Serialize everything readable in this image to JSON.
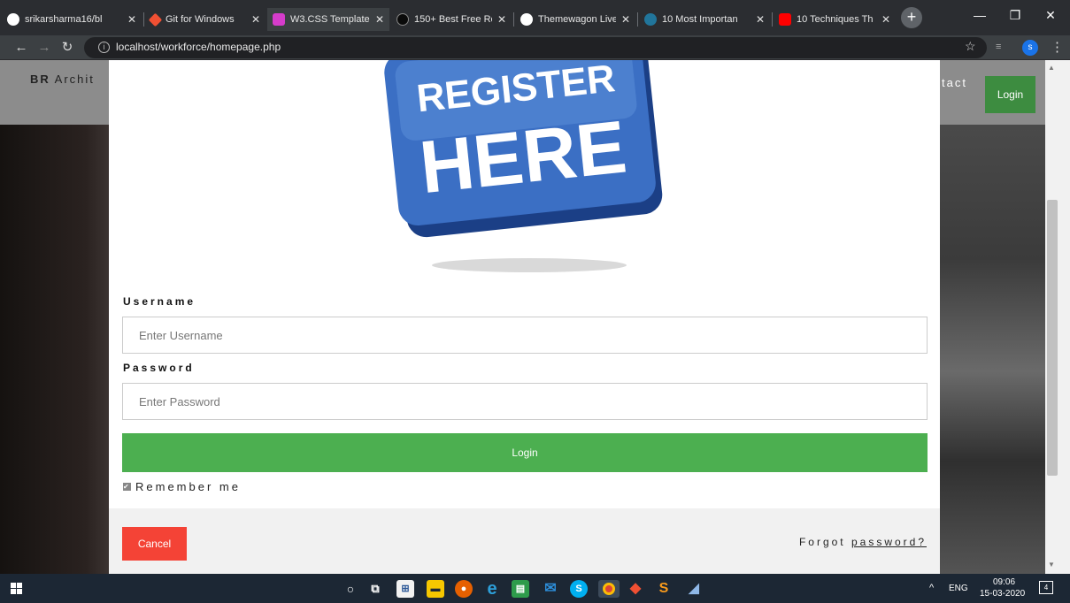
{
  "browser": {
    "tabs": [
      {
        "title": "srikarsharma16/bl",
        "icon": "github-icon",
        "color": "#ffffff"
      },
      {
        "title": "Git for Windows",
        "icon": "git-icon",
        "color": "#f05033"
      },
      {
        "title": "W3.CSS Template",
        "icon": "w3css-icon",
        "color": "#d63ccb"
      },
      {
        "title": "150+ Best Free Re",
        "icon": "themefisher-icon",
        "color": "#0a0a0a"
      },
      {
        "title": "Themewagon Live",
        "icon": "themewagon-icon",
        "color": "#ffffff"
      },
      {
        "title": "10 Most Importan",
        "icon": "wordpress-icon",
        "color": "#21759b"
      },
      {
        "title": "10 Techniques Th",
        "icon": "youtube-icon",
        "color": "#ff0000"
      }
    ],
    "close_glyph": "✕",
    "newtab_glyph": "+",
    "url": "localhost/workforce/homepage.php",
    "info_glyph": "i",
    "profile_initial": "s",
    "window": {
      "minimize": "—",
      "restore": "❐",
      "close": "✕"
    }
  },
  "site": {
    "brand_bold": "BR",
    "brand_rest": " Archit",
    "nav_contact": "tact",
    "nav_login": "Login"
  },
  "modal": {
    "banner_line1": "REGISTER",
    "banner_line2": "HERE",
    "username_label": "Username",
    "username_placeholder": "Enter Username",
    "password_label": "Password",
    "password_placeholder": "Enter Password",
    "login_button": "Login",
    "remember_label": "Remember me",
    "remember_checked": true,
    "cancel_button": "Cancel",
    "forgot_prefix": "Forgot ",
    "forgot_link": "password?"
  },
  "taskbar": {
    "language": "ENG",
    "time": "09:06",
    "date": "15-03-2020",
    "notification_count": "4",
    "tray_chevron": "^"
  },
  "colors": {
    "login_green": "#4caf50",
    "nav_login_green": "#3d8c40",
    "cancel_red": "#f44336",
    "footer_gray": "#f1f1f1"
  }
}
